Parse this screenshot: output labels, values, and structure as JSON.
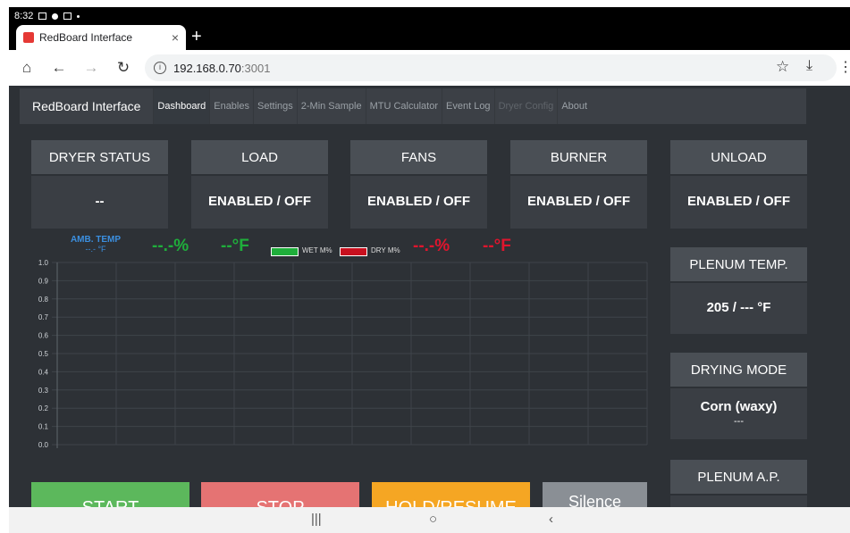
{
  "status_bar": {
    "time": "8:32"
  },
  "tab": {
    "title": "RedBoard Interface",
    "close": "×",
    "new_tab": "+"
  },
  "address": {
    "url_host": "192.168.0.70",
    "url_port": ":3001"
  },
  "navbar": {
    "brand": "RedBoard Interface",
    "items": [
      {
        "label": "Dashboard",
        "state": "active"
      },
      {
        "label": "Enables",
        "state": "normal"
      },
      {
        "label": "Settings",
        "state": "normal"
      },
      {
        "label": "2-Min Sample",
        "state": "normal"
      },
      {
        "label": "MTU Calculator",
        "state": "normal"
      },
      {
        "label": "Event Log",
        "state": "normal"
      },
      {
        "label": "Dryer Config",
        "state": "disabled"
      },
      {
        "label": "About",
        "state": "normal"
      }
    ]
  },
  "status_cards": [
    {
      "title": "DRYER STATUS",
      "value": "--"
    },
    {
      "title": "LOAD",
      "value": "ENABLED / OFF"
    },
    {
      "title": "FANS",
      "value": "ENABLED / OFF"
    },
    {
      "title": "BURNER",
      "value": "ENABLED / OFF"
    },
    {
      "title": "UNLOAD",
      "value": "ENABLED / OFF"
    }
  ],
  "side_cards": {
    "plenum_temp": {
      "title": "PLENUM TEMP.",
      "value": "205 / --- °F"
    },
    "drying_mode": {
      "title": "DRYING MODE",
      "value": "Corn (waxy)",
      "sub": "---"
    },
    "plenum_ap": {
      "title": "PLENUM A.P."
    }
  },
  "chart_header": {
    "amb_temp_label": "AMB. TEMP",
    "amb_temp_value": "--.- °F",
    "wet_pct": "--.-%",
    "wet_temp": "--°F",
    "wet_legend": "WET M%",
    "dry_legend": "DRY M%",
    "dry_pct": "--.-%",
    "dry_temp": "--°F"
  },
  "chart_data": {
    "type": "line",
    "title": "",
    "xlabel": "",
    "ylabel": "",
    "ylim": [
      0,
      1.0
    ],
    "yticks": [
      "1.0",
      "0.9",
      "0.8",
      "0.7",
      "0.6",
      "0.5",
      "0.4",
      "0.3",
      "0.2",
      "0.1",
      "0.0"
    ],
    "series": [
      {
        "name": "WET M%",
        "values": []
      },
      {
        "name": "DRY M%",
        "values": []
      }
    ],
    "grid": true
  },
  "colors": {
    "wet": "#1fae3b",
    "dry": "#e0152d",
    "start_btn": "#5cb85c",
    "stop_btn": "#e57373",
    "hold_btn": "#f5a623",
    "silence_btn": "#8a8f95",
    "amb_temp": "#3b8fe0"
  },
  "buttons": {
    "start": "START",
    "stop": "STOP",
    "hold": "HOLD/RESUME",
    "silence": "Silence"
  },
  "icons": {
    "home": "home-icon",
    "back": "back-arrow-icon",
    "forward": "forward-arrow-icon",
    "reload": "reload-icon",
    "info": "info-icon",
    "star": "star-icon",
    "download": "download-icon",
    "menu": "more-vert-icon"
  }
}
